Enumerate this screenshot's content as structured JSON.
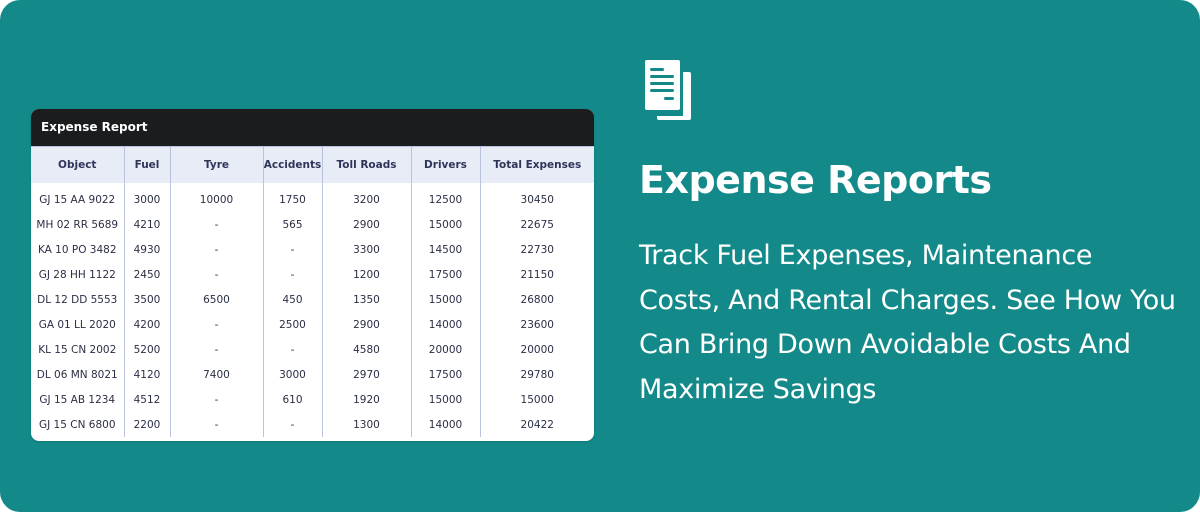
{
  "colors": {
    "background": "#138a89",
    "card_header": "#1b1c1e",
    "table_header_bg": "#e8ecf6",
    "text_white": "#ffffff"
  },
  "card": {
    "title": "Expense Report",
    "columns": [
      "Object",
      "Fuel",
      "Tyre",
      "Accidents",
      "Toll Roads",
      "Drivers",
      "Total Expenses"
    ],
    "rows": [
      [
        "GJ 15 AA 9022",
        "3000",
        "10000",
        "1750",
        "3200",
        "12500",
        "30450"
      ],
      [
        "MH 02 RR 5689",
        "4210",
        "-",
        "565",
        "2900",
        "15000",
        "22675"
      ],
      [
        "KA 10 PO 3482",
        "4930",
        "-",
        "-",
        "3300",
        "14500",
        "22730"
      ],
      [
        "GJ 28 HH 1122",
        "2450",
        "-",
        "-",
        "1200",
        "17500",
        "21150"
      ],
      [
        "DL 12 DD 5553",
        "3500",
        "6500",
        "450",
        "1350",
        "15000",
        "26800"
      ],
      [
        "GA 01 LL 2020",
        "4200",
        "-",
        "2500",
        "2900",
        "14000",
        "23600"
      ],
      [
        "KL 15 CN 2002",
        "5200",
        "-",
        "-",
        "4580",
        "20000",
        "20000"
      ],
      [
        "DL 06 MN 8021",
        "4120",
        "7400",
        "3000",
        "2970",
        "17500",
        "29780"
      ],
      [
        "GJ 15 AB 1234",
        "4512",
        "-",
        "610",
        "1920",
        "15000",
        "15000"
      ],
      [
        "GJ 15 CN 6800",
        "2200",
        "-",
        "-",
        "1300",
        "14000",
        "20422"
      ]
    ]
  },
  "feature": {
    "icon": "documents-icon",
    "title": "Expense Reports",
    "description": "Track Fuel Expenses, Maintenance Costs, And Rental Charges. See How You Can Bring Down Avoidable Costs And Maximize Savings"
  }
}
